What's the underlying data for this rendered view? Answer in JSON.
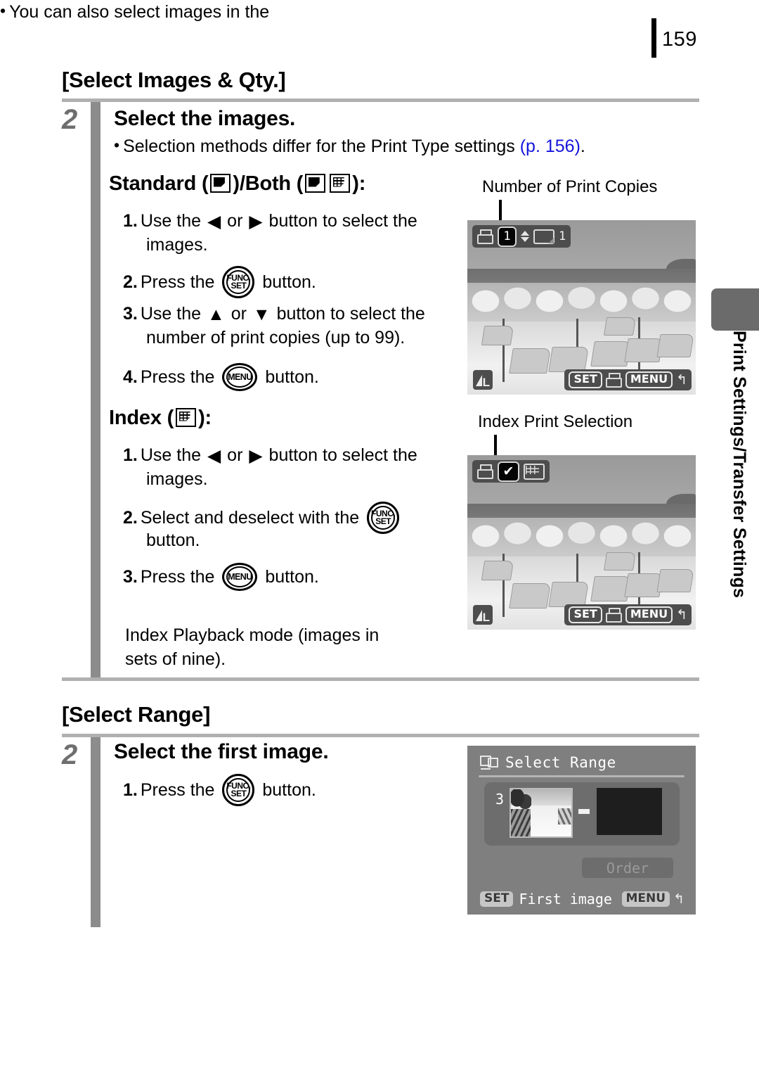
{
  "page": {
    "number": "159",
    "side_tab_label": "Print Settings/Transfer Settings"
  },
  "sections": [
    {
      "title": "[Select Images & Qty.]",
      "step_number": "2",
      "step_heading": "Select the images.",
      "intro_bullet": {
        "text_before": "Selection methods differ for the Print Type settings ",
        "link": "(p. 156)",
        "text_after": "."
      },
      "subsections": [
        {
          "heading_prefix": "Standard (",
          "heading_mid": ")/Both (",
          "heading_suffix": "):",
          "steps": [
            {
              "num": "1.",
              "line1_a": "Use the",
              "line1_b": "or",
              "line1_c": "button to select the",
              "line2": "images."
            },
            {
              "num": "2.",
              "line1_a": "Press the",
              "line1_c": "button."
            },
            {
              "num": "3.",
              "line1_a": "Use the",
              "line1_b": "or",
              "line1_c": "button to select the",
              "line2": "number of print copies (up to 99)."
            },
            {
              "num": "4.",
              "line1_a": "Press the",
              "line1_c": "button."
            }
          ]
        },
        {
          "heading_prefix": "Index (",
          "heading_suffix": "):",
          "steps": [
            {
              "num": "1.",
              "line1_a": "Use the",
              "line1_b": "or",
              "line1_c": "button to select the",
              "line2": "images."
            },
            {
              "num": "2.",
              "line1_a": "Select and deselect with the",
              "line2": "button."
            },
            {
              "num": "3.",
              "line1_a": "Press the",
              "line1_c": "button."
            }
          ],
          "note": {
            "line1": "You can also select images in the",
            "line2": "Index Playback mode (images in",
            "line3": "sets of nine)."
          }
        }
      ]
    },
    {
      "title": "[Select Range]",
      "step_number": "2",
      "step_heading": "Select the first image.",
      "steps": [
        {
          "num": "1.",
          "line1_a": "Press the",
          "line1_c": "button."
        }
      ]
    }
  ],
  "figures": {
    "copies": {
      "caption": "Number of Print Copies",
      "topbar": {
        "printer_icon": "printer-icon",
        "copies_value": "1",
        "updown_icon": "up-down-arrows-icon",
        "frame_icon": "single-frame-icon",
        "frame_count": "1"
      },
      "bottombar": {
        "set_key": "SET",
        "print_icon": "printer-icon",
        "menu_key": "MENU",
        "back_icon": "return-arrow-icon"
      },
      "quality_badge": "L"
    },
    "index": {
      "caption": "Index Print Selection",
      "topbar": {
        "printer_icon": "printer-icon",
        "check_mark": "✔",
        "index_icon": "index-grid-icon"
      },
      "bottombar": {
        "set_key": "SET",
        "print_icon": "printer-icon",
        "menu_key": "MENU",
        "back_icon": "return-arrow-icon"
      },
      "quality_badge": "L"
    },
    "range": {
      "title": "Select Range",
      "range_icon": "select-range-icon",
      "index_number": "3",
      "dash": "-",
      "order_button": "Order",
      "footer": {
        "set_key": "SET",
        "set_label": "First image",
        "menu_key": "MENU",
        "back_icon": "return-arrow-icon"
      }
    }
  },
  "glyphs": {
    "arrow_left": "◀",
    "arrow_right": "▶",
    "arrow_up": "▲",
    "arrow_down": "▼",
    "bullet": "•",
    "func_set_line1": "FUNC.",
    "func_set_line2": "SET",
    "menu_label": "MENU",
    "back_arrow": "↰"
  },
  "colors": {
    "rule": "#b0b0b0",
    "step_bar": "#8c8c8c",
    "step_number": "#6e6e6e",
    "link": "#1414dc",
    "lcd_bg": "#8d8d8d",
    "lcd_bar": "#4d4d4d",
    "side_tab": "#6b6b6b"
  }
}
